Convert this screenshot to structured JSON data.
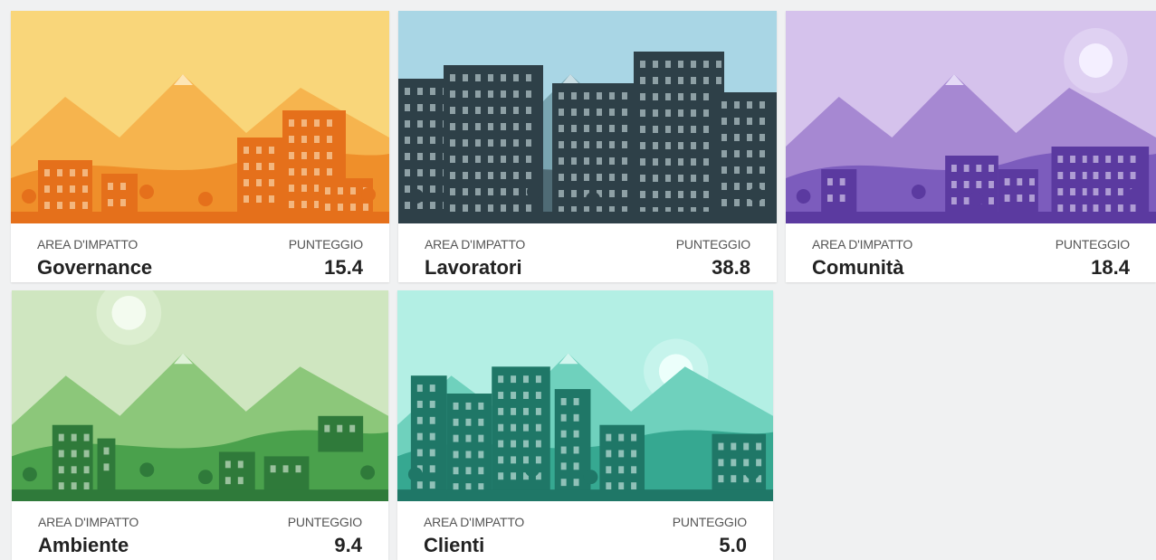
{
  "cards": [
    {
      "area_label": "AREA D'IMPATTO",
      "score_label": "PUNTEGGIO",
      "name": "Governance",
      "score": "15.4",
      "theme": {
        "sky": "#f9d67a",
        "back": "#f6b44e",
        "mid": "#ef8f2a",
        "front": "#e5701b",
        "accent": "#fff1d0"
      }
    },
    {
      "area_label": "AREA D'IMPATTO",
      "score_label": "PUNTEGGIO",
      "name": "Lavoratori",
      "score": "38.8",
      "theme": {
        "sky": "#a9d6e5",
        "back": "#7aa5b1",
        "mid": "#4f6b75",
        "front": "#2e4048",
        "accent": "#dfeef3"
      }
    },
    {
      "area_label": "AREA D'IMPATTO",
      "score_label": "PUNTEGGIO",
      "name": "Comunità",
      "score": "18.4",
      "theme": {
        "sky": "#d5c2ec",
        "back": "#a688d2",
        "mid": "#7c5cbd",
        "front": "#5b3aa0",
        "accent": "#f4efff"
      }
    },
    {
      "area_label": "AREA D'IMPATTO",
      "score_label": "PUNTEGGIO",
      "name": "Ambiente",
      "score": "9.4",
      "theme": {
        "sky": "#cfe6c0",
        "back": "#8cc77a",
        "mid": "#4aa14c",
        "front": "#2f7a3a",
        "accent": "#f3fbef"
      }
    },
    {
      "area_label": "AREA D'IMPATTO",
      "score_label": "PUNTEGGIO",
      "name": "Clienti",
      "score": "5.0",
      "theme": {
        "sky": "#b3efe4",
        "back": "#6fd1bd",
        "mid": "#36a891",
        "front": "#1f7767",
        "accent": "#ecfffb"
      }
    }
  ]
}
